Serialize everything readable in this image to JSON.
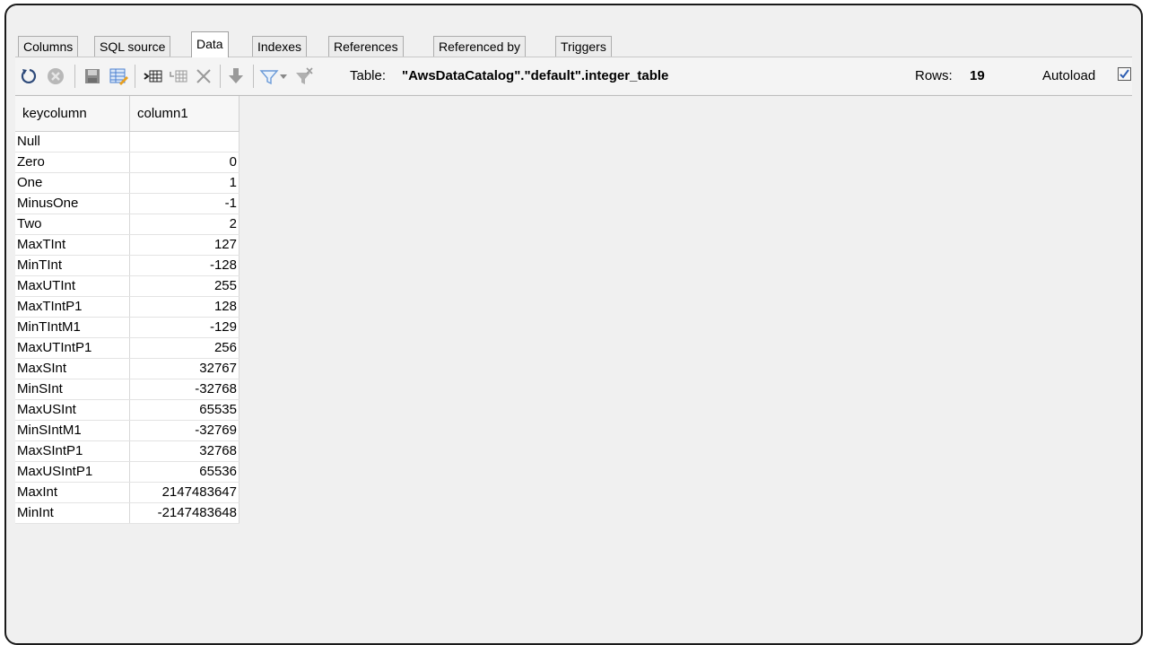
{
  "tabs": [
    {
      "label": "Columns",
      "active": false
    },
    {
      "label": "SQL source",
      "active": false
    },
    {
      "label": "Data",
      "active": true
    },
    {
      "label": "Indexes",
      "active": false
    },
    {
      "label": "References",
      "active": false
    },
    {
      "label": "Referenced by",
      "active": false
    },
    {
      "label": "Triggers",
      "active": false
    }
  ],
  "toolbar": {
    "icons": [
      "refresh-icon",
      "stop-icon",
      "save-icon",
      "edit-icon",
      "insert-row-icon",
      "duplicate-row-icon",
      "delete-icon",
      "commit-icon",
      "filter-icon",
      "filter-dropdown-icon",
      "clear-filter-icon"
    ],
    "table_label": "Table:",
    "table_name": "\"AwsDataCatalog\".\"default\".integer_table",
    "rows_label": "Rows:",
    "rows_value": "19",
    "autoload_label": "Autoload",
    "autoload_checked": true
  },
  "grid": {
    "columns": [
      "keycolumn",
      "column1"
    ],
    "rows": [
      [
        "Null",
        ""
      ],
      [
        "Zero",
        "0"
      ],
      [
        "One",
        "1"
      ],
      [
        "MinusOne",
        "-1"
      ],
      [
        "Two",
        "2"
      ],
      [
        "MaxTInt",
        "127"
      ],
      [
        "MinTInt",
        "-128"
      ],
      [
        "MaxUTInt",
        "255"
      ],
      [
        "MaxTIntP1",
        "128"
      ],
      [
        "MinTIntM1",
        "-129"
      ],
      [
        "MaxUTIntP1",
        "256"
      ],
      [
        "MaxSInt",
        "32767"
      ],
      [
        "MinSInt",
        "-32768"
      ],
      [
        "MaxUSInt",
        "65535"
      ],
      [
        "MinSIntM1",
        "-32769"
      ],
      [
        "MaxSIntP1",
        "32768"
      ],
      [
        "MaxUSIntP1",
        "65536"
      ],
      [
        "MaxInt",
        "2147483647"
      ],
      [
        "MinInt",
        "-2147483648"
      ]
    ]
  },
  "colors": {
    "accent": "#4a7fd0",
    "stop": "#c04040"
  }
}
